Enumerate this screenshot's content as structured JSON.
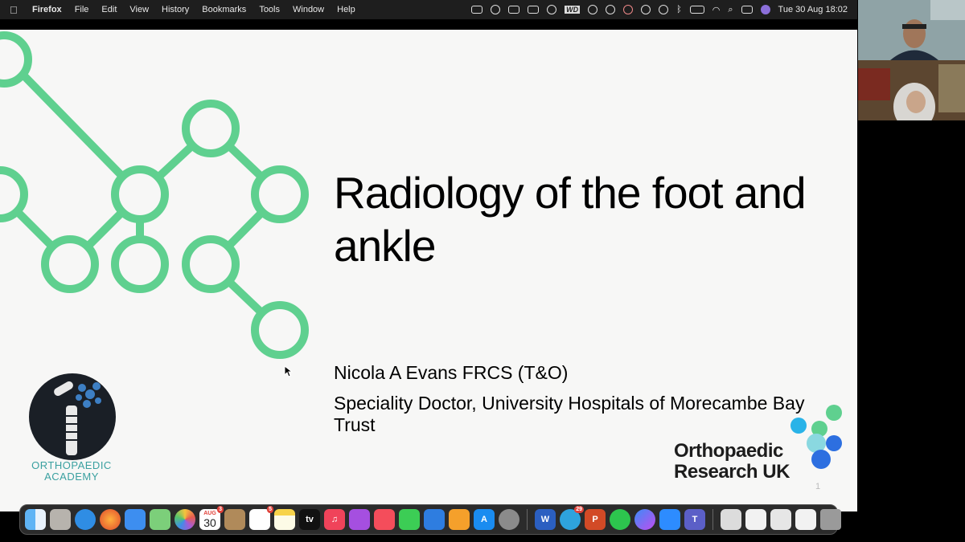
{
  "menubar": {
    "app_name": "Firefox",
    "menus": [
      "File",
      "Edit",
      "View",
      "History",
      "Bookmarks",
      "Tools",
      "Window",
      "Help"
    ],
    "status_icons": [
      "upload-icon",
      "microphone-icon",
      "screen-record-icon",
      "camera-icon",
      "checkmark-icon",
      "wd-drive-icon",
      "sync-icon",
      "record-icon",
      "badge-app-icon",
      "airdrop-icon",
      "play-icon",
      "bluetooth-icon",
      "battery-icon",
      "wifi-icon",
      "search-icon",
      "control-center-icon",
      "siri-icon"
    ],
    "wd_label": "WD",
    "datetime": "Tue 30 Aug  18:02"
  },
  "slide": {
    "title": "Radiology of the foot and ankle",
    "author": "Nicola A Evans FRCS (T&O)",
    "affiliation": "Speciality Doctor, University Hospitals of Morecambe Bay Trust",
    "academy_logo_text": "ORTHOPAEDIC ACADEMY",
    "oruk_logo_line1": "Orthopaedic",
    "oruk_logo_line2": "Research UK",
    "page_number": "1",
    "accent_color": "#5fd08f"
  },
  "dock": {
    "calendar_month": "AUG",
    "calendar_day": "30",
    "calendar_badge": "3",
    "reminders_badge": "5",
    "appletv_label": "tv",
    "telegram_badge": "29",
    "apps": [
      "finder",
      "launchpad",
      "safari",
      "firefox",
      "mail",
      "maps",
      "photos",
      "calendar",
      "contacts",
      "reminders",
      "notes",
      "apple-tv",
      "music",
      "podcasts",
      "news",
      "facetime",
      "keynote",
      "pages",
      "app-store",
      "system-preferences",
      "word",
      "telegram",
      "powerpoint",
      "whatsapp",
      "messenger",
      "zoom",
      "teams",
      "scanner-stack",
      "document-stack-1",
      "document-stack-2",
      "document-stack-3",
      "trash"
    ]
  }
}
